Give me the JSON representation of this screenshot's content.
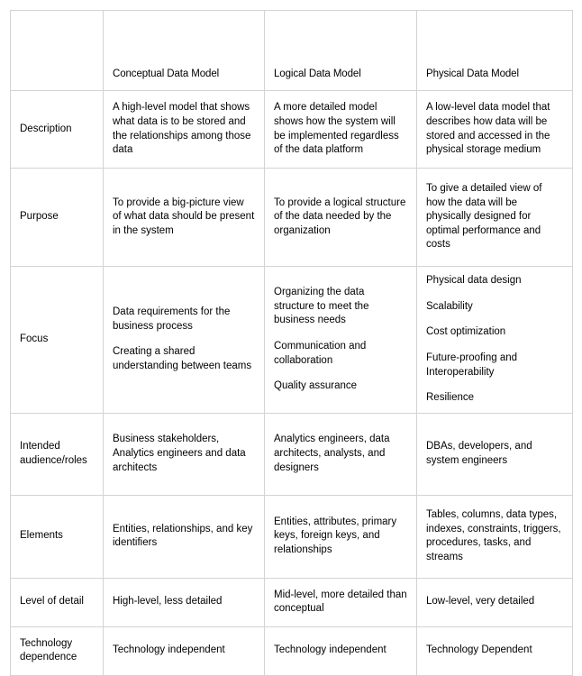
{
  "table": {
    "columns": [
      {
        "key": "label",
        "header": ""
      },
      {
        "key": "conceptual",
        "header": "Conceptual Data Model"
      },
      {
        "key": "logical",
        "header": "Logical Data Model"
      },
      {
        "key": "physical",
        "header": "Physical Data Model"
      }
    ],
    "rows": [
      {
        "label": "Description",
        "conceptual": [
          "A high-level model that shows what data is to be stored and the relationships among those data"
        ],
        "logical": [
          "A more detailed model shows how the system will be implemented regardless of the data platform"
        ],
        "physical": [
          "A low-level data model that describes how data will be stored and accessed in the physical storage medium"
        ]
      },
      {
        "label": "Purpose",
        "conceptual": [
          "To provide a big-picture view of what data should be present in the system"
        ],
        "logical": [
          "To provide a logical structure of the data needed by the organization"
        ],
        "physical": [
          "To give a detailed view of how the data will be physically designed for optimal performance and costs"
        ]
      },
      {
        "label": "Focus",
        "conceptual": [
          "Data requirements for the business process",
          "Creating a shared understanding between teams"
        ],
        "logical": [
          "Organizing the data structure to meet the business needs",
          "Communication and collaboration",
          "Quality assurance"
        ],
        "physical": [
          "Physical data design",
          "Scalability",
          "Cost optimization",
          "Future-proofing and Interoperability",
          "Resilience"
        ]
      },
      {
        "label": "Intended audience/roles",
        "conceptual": [
          "Business stakeholders, Analytics engineers and data architects"
        ],
        "logical": [
          "Analytics engineers, data architects, analysts, and designers"
        ],
        "physical": [
          "DBAs, developers, and system engineers"
        ]
      },
      {
        "label": "Elements",
        "conceptual": [
          "Entities, relationships, and key identifiers"
        ],
        "logical": [
          "Entities, attributes, primary keys, foreign keys, and relationships"
        ],
        "physical": [
          "Tables, columns, data types, indexes, constraints, triggers, procedures, tasks, and streams"
        ]
      },
      {
        "label": "Level of detail",
        "conceptual": [
          "High-level, less detailed"
        ],
        "logical": [
          "Mid-level, more detailed than conceptual"
        ],
        "physical": [
          "Low-level, very detailed"
        ]
      },
      {
        "label": "Technology dependence",
        "conceptual": [
          "Technology independent"
        ],
        "logical": [
          "Technology independent"
        ],
        "physical": [
          "Technology Dependent"
        ]
      }
    ]
  },
  "colors": {
    "border": "#d3d3d3",
    "text": "#000000",
    "background": "#ffffff"
  }
}
